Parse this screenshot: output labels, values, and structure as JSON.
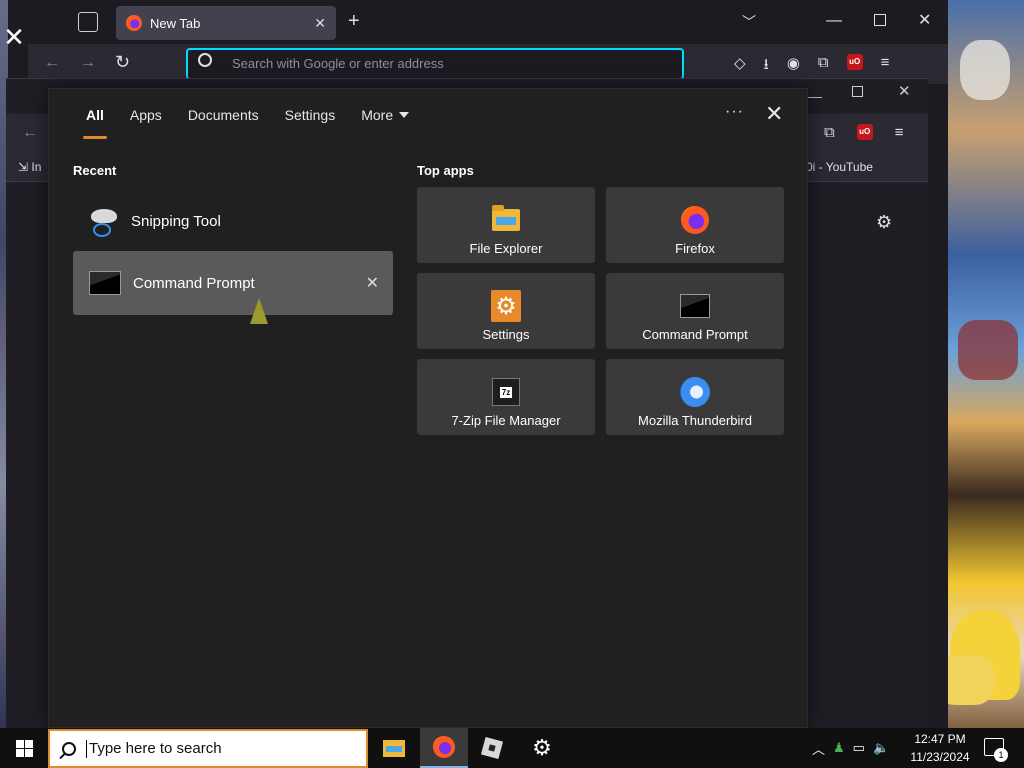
{
  "firefox": {
    "tab_title": "New Tab",
    "url_placeholder": "Search with Google or enter address"
  },
  "browser2": {
    "bookmark_left": "In",
    "bookmark_youtube": "0i - YouTube"
  },
  "search_panel": {
    "tabs": [
      {
        "label": "All",
        "active": true
      },
      {
        "label": "Apps"
      },
      {
        "label": "Documents"
      },
      {
        "label": "Settings"
      },
      {
        "label": "More"
      }
    ],
    "more_options": "···",
    "recent_heading": "Recent",
    "recent": [
      {
        "label": "Snipping Tool",
        "icon": "snipping-tool-icon"
      },
      {
        "label": "Command Prompt",
        "icon": "command-prompt-icon",
        "hovered": true
      }
    ],
    "top_apps_heading": "Top apps",
    "top_apps": [
      {
        "label": "File Explorer",
        "icon": "file-explorer-icon"
      },
      {
        "label": "Firefox",
        "icon": "firefox-icon"
      },
      {
        "label": "Settings",
        "icon": "settings-icon"
      },
      {
        "label": "Command Prompt",
        "icon": "command-prompt-icon"
      },
      {
        "label": "7-Zip File Manager",
        "icon": "7zip-icon"
      },
      {
        "label": "Mozilla Thunderbird",
        "icon": "thunderbird-icon"
      }
    ]
  },
  "taskbar": {
    "search_placeholder": "Type here to search",
    "time": "12:47 PM",
    "date": "11/23/2024",
    "notification_count": "1"
  },
  "colors": {
    "accent": "#e08a2b",
    "panel_bg": "#202020",
    "tile_bg": "#3a3a3a"
  }
}
